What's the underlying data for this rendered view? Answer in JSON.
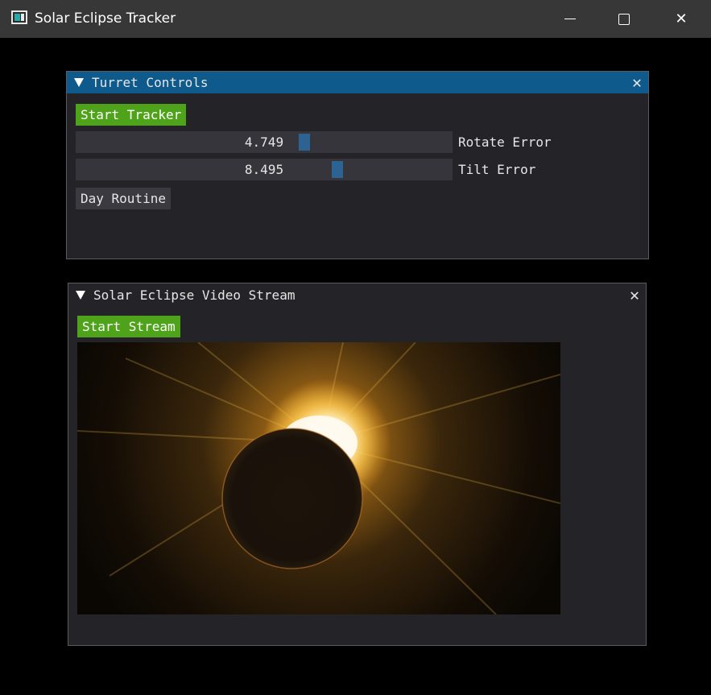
{
  "window": {
    "title": "Solar Eclipse Tracker",
    "minimize_icon": "minimize-icon",
    "maximize_icon": "maximize-icon",
    "close_glyph": "✕"
  },
  "turret": {
    "title": "Turret Controls",
    "collapse_glyph": "▼",
    "close_glyph": "✕",
    "start_tracker_label": "Start Tracker",
    "rotate_value": "4.749",
    "rotate_label": "Rotate Error",
    "rotate_fraction": 0.61,
    "tilt_value": "8.495",
    "tilt_label": "Tilt Error",
    "tilt_fraction": 0.7,
    "day_routine_label": "Day Routine"
  },
  "stream": {
    "title": "Solar Eclipse Video Stream",
    "collapse_glyph": "▼",
    "close_glyph": "✕",
    "start_stream_label": "Start Stream",
    "image_subject": "diamond-ring solar eclipse"
  },
  "colors": {
    "title_active": "#0f5a8d",
    "panel_bg": "#242428",
    "button_green": "#4ea31a",
    "slider_grab": "#2c6393"
  }
}
